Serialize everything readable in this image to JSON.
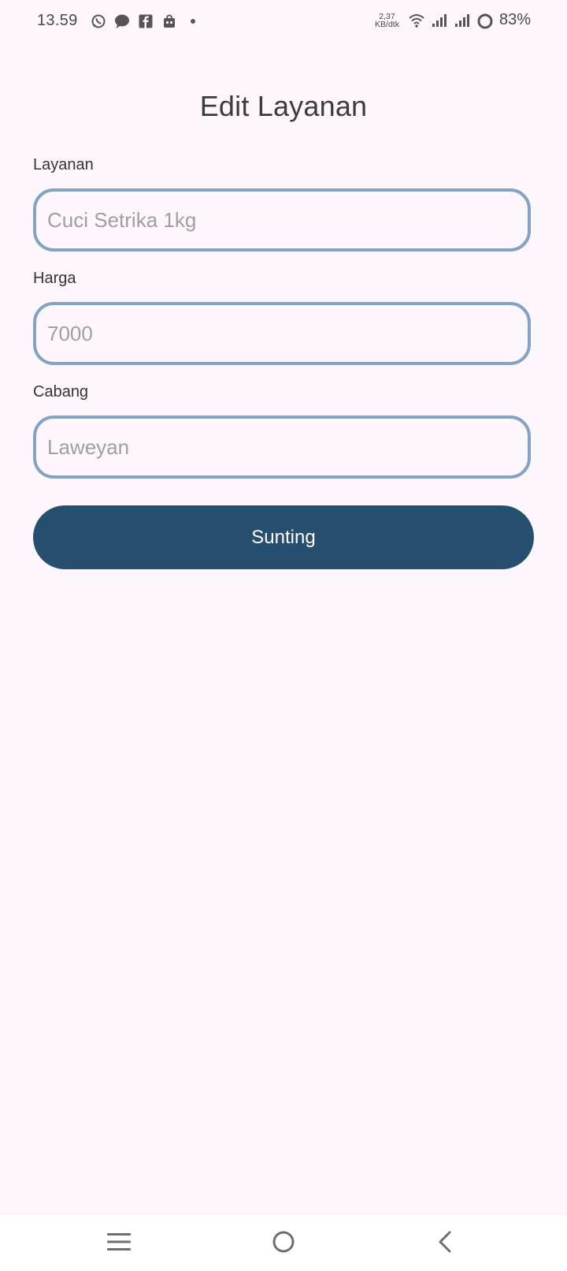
{
  "status_bar": {
    "time": "13.59",
    "net_speed_value": "2,37",
    "net_speed_unit": "KB/dtk",
    "battery": "83%",
    "notification_icons": [
      "whatsapp-icon",
      "message-icon",
      "facebook-icon",
      "bag-icon",
      "dot-icon"
    ],
    "system_icons": [
      "wifi-icon",
      "signal-icon",
      "signal-icon",
      "battery-ring-icon"
    ]
  },
  "page": {
    "title": "Edit Layanan"
  },
  "form": {
    "layanan": {
      "label": "Layanan",
      "placeholder": "Cuci Setrika 1kg"
    },
    "harga": {
      "label": "Harga",
      "placeholder": "7000"
    },
    "cabang": {
      "label": "Cabang",
      "placeholder": "Laweyan"
    },
    "submit_label": "Sunting"
  },
  "nav_bar": {
    "icons": [
      "menu-icon",
      "home-icon",
      "back-icon"
    ]
  },
  "colors": {
    "background": "#fdf7fd",
    "input_border": "#84a3c3",
    "button": "#264e6f",
    "button_text": "#ffffff",
    "placeholder": "#a19ea3"
  }
}
